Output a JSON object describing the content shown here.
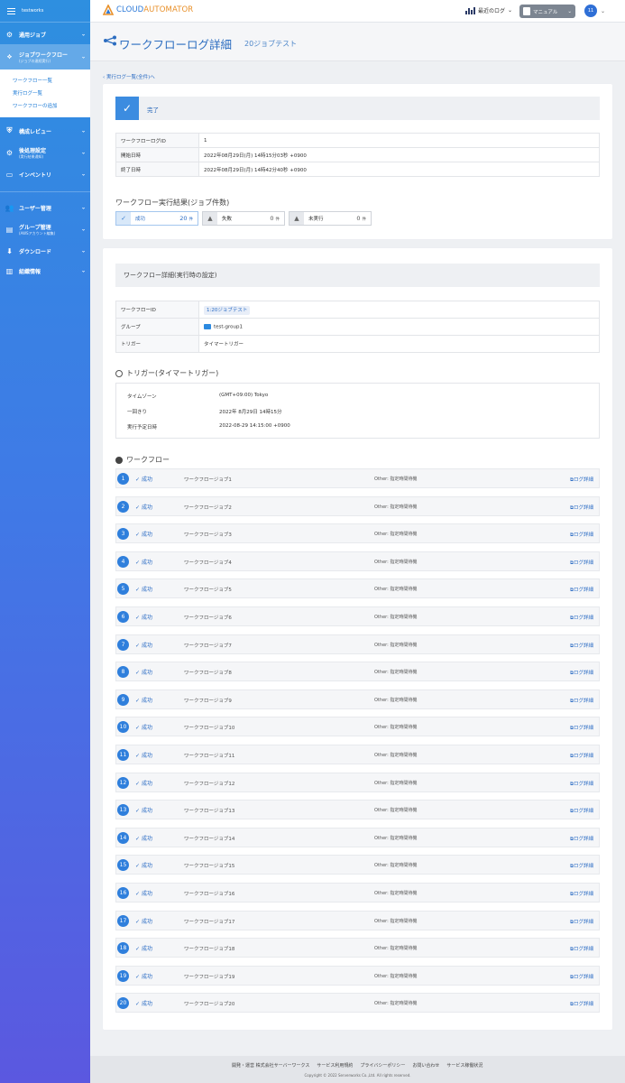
{
  "sidebar": {
    "org": "testworks",
    "items": [
      {
        "label": "通用ジョブ",
        "sub": "",
        "icon": "gear-icon"
      },
      {
        "label": "ジョブワークフロー",
        "sub": "(ジョブの連続実行)",
        "icon": "workflow-icon"
      },
      {
        "label": "構成レビュー",
        "sub": "",
        "icon": "shield-icon"
      },
      {
        "label": "後処理設定",
        "sub": "(実行結果通知)",
        "icon": "settings-icon"
      },
      {
        "label": "インベントリ",
        "sub": "",
        "icon": "inventory-icon"
      },
      {
        "label": "ユーザー管理",
        "sub": "",
        "icon": "users-icon"
      },
      {
        "label": "グループ管理",
        "sub": "(AWSアカウント編集)",
        "icon": "briefcase-icon"
      },
      {
        "label": "ダウンロード",
        "sub": "",
        "icon": "download-icon"
      },
      {
        "label": "組織情報",
        "sub": "",
        "icon": "building-icon"
      }
    ],
    "submenu": [
      "ワークフロー一覧",
      "実行ログ一覧",
      "ワークフローの追加"
    ]
  },
  "header": {
    "logo_part1": "CLOUD",
    "logo_part2": "AUTOMATOR",
    "recent_logs": "最近のログ",
    "manual": "マニュアル",
    "avatar": "11"
  },
  "page": {
    "title": "ワークフローログ詳細",
    "subtitle": "20ジョブテスト",
    "back_link": "実行ログ一覧(全件)へ"
  },
  "status": {
    "label": "完了",
    "color": "#3c8ce0"
  },
  "log_info": [
    {
      "key": "ワークフローログID",
      "value": "1"
    },
    {
      "key": "開始日時",
      "value": "2022年08月29日(月) 14時15分03秒 +0900"
    },
    {
      "key": "終了日時",
      "value": "2022年08月29日(月) 14時42分40秒 +0900"
    }
  ],
  "results": {
    "title": "ワークフロー実行結果(ジョブ件数)",
    "unit": "件",
    "items": [
      {
        "label": "成功",
        "count": "20"
      },
      {
        "label": "失敗",
        "count": "0"
      },
      {
        "label": "未実行",
        "count": "0"
      }
    ]
  },
  "detail": {
    "title": "ワークフロー詳細(実行時の設定)",
    "rows": [
      {
        "key": "ワークフローID",
        "value": "1:20ジョブテスト"
      },
      {
        "key": "グループ",
        "value": "test-group1"
      },
      {
        "key": "トリガー",
        "value": "タイマートリガー"
      }
    ]
  },
  "trigger": {
    "title": "トリガー(タイマートリガー)",
    "rows": [
      {
        "key": "タイムゾーン",
        "value": "(GMT+09:00) Tokyo"
      },
      {
        "key": "一回きり",
        "value": "2022年 8月29日 14時15分"
      },
      {
        "key": "実行予定日時",
        "value": "2022-08-29 14:15:00 +0900"
      }
    ]
  },
  "workflow": {
    "title": "ワークフロー",
    "status_label": "成功",
    "action": "Other: 指定時間待機",
    "log_label": "ログ詳細",
    "jobs": [
      {
        "num": "1",
        "name": "ワークフロージョブ1"
      },
      {
        "num": "2",
        "name": "ワークフロージョブ2"
      },
      {
        "num": "3",
        "name": "ワークフロージョブ3"
      },
      {
        "num": "4",
        "name": "ワークフロージョブ4"
      },
      {
        "num": "5",
        "name": "ワークフロージョブ5"
      },
      {
        "num": "6",
        "name": "ワークフロージョブ6"
      },
      {
        "num": "7",
        "name": "ワークフロージョブ7"
      },
      {
        "num": "8",
        "name": "ワークフロージョブ8"
      },
      {
        "num": "9",
        "name": "ワークフロージョブ9"
      },
      {
        "num": "10",
        "name": "ワークフロージョブ10"
      },
      {
        "num": "11",
        "name": "ワークフロージョブ11"
      },
      {
        "num": "12",
        "name": "ワークフロージョブ12"
      },
      {
        "num": "13",
        "name": "ワークフロージョブ13"
      },
      {
        "num": "14",
        "name": "ワークフロージョブ14"
      },
      {
        "num": "15",
        "name": "ワークフロージョブ15"
      },
      {
        "num": "16",
        "name": "ワークフロージョブ16"
      },
      {
        "num": "17",
        "name": "ワークフロージョブ17"
      },
      {
        "num": "18",
        "name": "ワークフロージョブ18"
      },
      {
        "num": "19",
        "name": "ワークフロージョブ19"
      },
      {
        "num": "20",
        "name": "ワークフロージョブ20"
      }
    ]
  },
  "footer": {
    "links": [
      "開発・運営 株式会社サーバーワークス",
      "サービス利用規約",
      "プライバシーポリシー",
      "お問い合わせ",
      "サービス稼働状況"
    ],
    "copyright": "Copyright © 2022 Serverworks Co.,Ltd. All rights reserved."
  },
  "colors": {
    "primary": "#2c79d8",
    "accent": "#e8902a",
    "sidebar_top": "#2e8fe0",
    "sidebar_bottom": "#5b58e0"
  }
}
